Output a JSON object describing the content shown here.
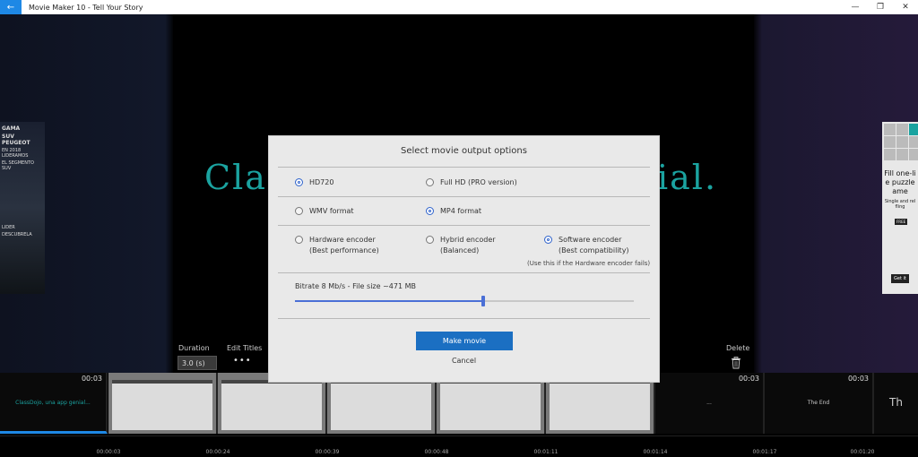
{
  "titlebar": {
    "back_icon": "←",
    "title": "Movie Maker 10 - Tell Your Story",
    "minimize": "—",
    "maximize": "❐",
    "close": "✕"
  },
  "preview": {
    "text_left": "Clas",
    "text_right": "ial."
  },
  "ad_left": {
    "lines": [
      "GAMA",
      "SUV PEUGEOT",
      "EN 2018 LIDERAMOS",
      "EL SEGMENTO SUV",
      "LIDER",
      "DESCUBRELA"
    ]
  },
  "ad_right": {
    "heading": "Fill one-li e puzzle ame",
    "sub": "Single and rel fling",
    "free": "FREE",
    "cta": "Get it"
  },
  "toolbar": {
    "duration_label": "Duration",
    "duration_value": "3.0 (s)",
    "edit_titles_label": "Edit Titles",
    "more_dots": "•••",
    "delete_label": "Delete"
  },
  "timeline": {
    "clips": [
      {
        "time": "00:03",
        "text": "ClassDojo, una app genial..."
      },
      {
        "time": "",
        "text": ""
      },
      {
        "time": "",
        "text": ""
      },
      {
        "time": "",
        "text": ""
      },
      {
        "time": "",
        "text": ""
      },
      {
        "time": "",
        "text": ""
      },
      {
        "time": "00:03",
        "text": "..."
      },
      {
        "time": "00:03",
        "text": "The End"
      },
      {
        "time": "",
        "text": "Th"
      }
    ]
  },
  "ruler": {
    "ticks": [
      "00:00:03",
      "00:00:24",
      "00:00:39",
      "00:00:48",
      "00:01:11",
      "00:01:14",
      "00:01:17",
      "00:01:20"
    ]
  },
  "modal": {
    "title": "Select movie output options",
    "resolution": {
      "hd720": "HD720",
      "full_hd": "Full HD (PRO version)",
      "selected": "hd720"
    },
    "format": {
      "wmv": "WMV format",
      "mp4": "MP4 format",
      "selected": "mp4"
    },
    "encoder": {
      "hardware": "Hardware encoder",
      "hardware_sub": "(Best performance)",
      "hybrid": "Hybrid encoder",
      "hybrid_sub": "(Balanced)",
      "software": "Software encoder",
      "software_sub": "(Best compatibility)",
      "note": "(Use this if the Hardware encoder fails)",
      "selected": "software"
    },
    "bitrate_label": "Bitrate 8 Mb/s - File size ~471 MB",
    "bitrate_fraction": 0.556,
    "make_movie": "Make movie",
    "cancel": "Cancel"
  },
  "colors": {
    "accent": "#1b6fc2",
    "radio_selected": "#3366cc",
    "title_teal": "#1ba3a0"
  }
}
